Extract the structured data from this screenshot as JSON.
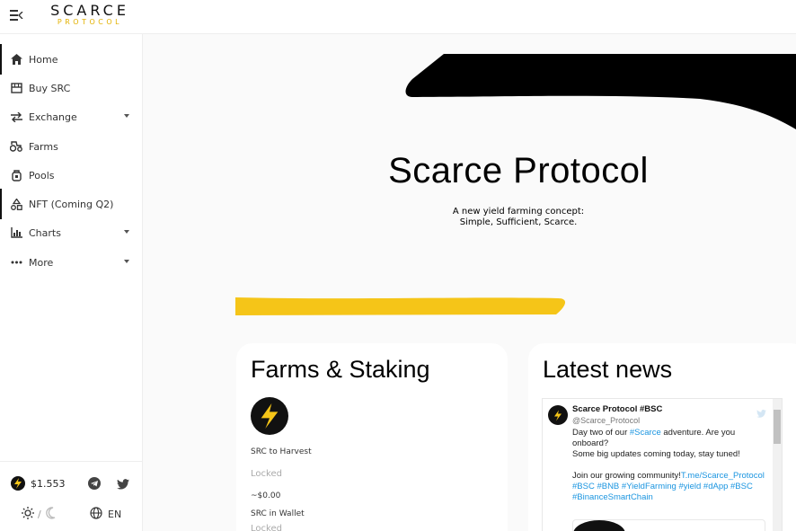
{
  "header": {
    "logo_main": "SCARCE",
    "logo_sub": "PROTOCOL"
  },
  "sidebar": {
    "items": [
      {
        "label": "Home",
        "icon": "home-icon",
        "active": true
      },
      {
        "label": "Buy SRC",
        "icon": "store-icon"
      },
      {
        "label": "Exchange",
        "icon": "swap-icon",
        "dropdown": true
      },
      {
        "label": "Farms",
        "icon": "tractor-icon"
      },
      {
        "label": "Pools",
        "icon": "pool-icon"
      },
      {
        "label": "NFT (Coming Q2)",
        "icon": "shapes-icon",
        "active": true
      },
      {
        "label": "Charts",
        "icon": "chart-icon",
        "dropdown": true
      },
      {
        "label": "More",
        "icon": "more-icon",
        "dropdown": true
      }
    ],
    "price": "$1.553",
    "language": "EN",
    "theme_separator": "/"
  },
  "hero": {
    "title": "Scarce Protocol",
    "subtitle_line1": "A new yield farming concept:",
    "subtitle_line2": "Simple, Sufficient, Scarce."
  },
  "farms_card": {
    "title": "Farms & Staking",
    "harvest_label": "SRC to Harvest",
    "harvest_value": "Locked",
    "harvest_usd": "~$0.00",
    "wallet_label": "SRC in Wallet",
    "wallet_value": "Locked"
  },
  "news_card": {
    "title": "Latest news",
    "tweet": {
      "name": "Scarce Protocol #BSC",
      "handle": "@Scarce_Protocol",
      "line1_pre": "Day two of our ",
      "line1_link": "#Scarce",
      "line1_post": " adventure. Are you",
      "line2": "onboard?",
      "line3": "Some big updates coming today, stay tuned!",
      "line4_pre": "Join our growing community!",
      "line4_link": "T.me/Scarce_Protocol",
      "hashtags1": "#BSC #BNB #YieldFarming #yield #dApp #BSC",
      "hashtags2": "#BinanceSmartChain"
    }
  },
  "colors": {
    "brand_yellow": "#f5c518",
    "accent_black": "#000000",
    "link_blue": "#1b95e0"
  }
}
